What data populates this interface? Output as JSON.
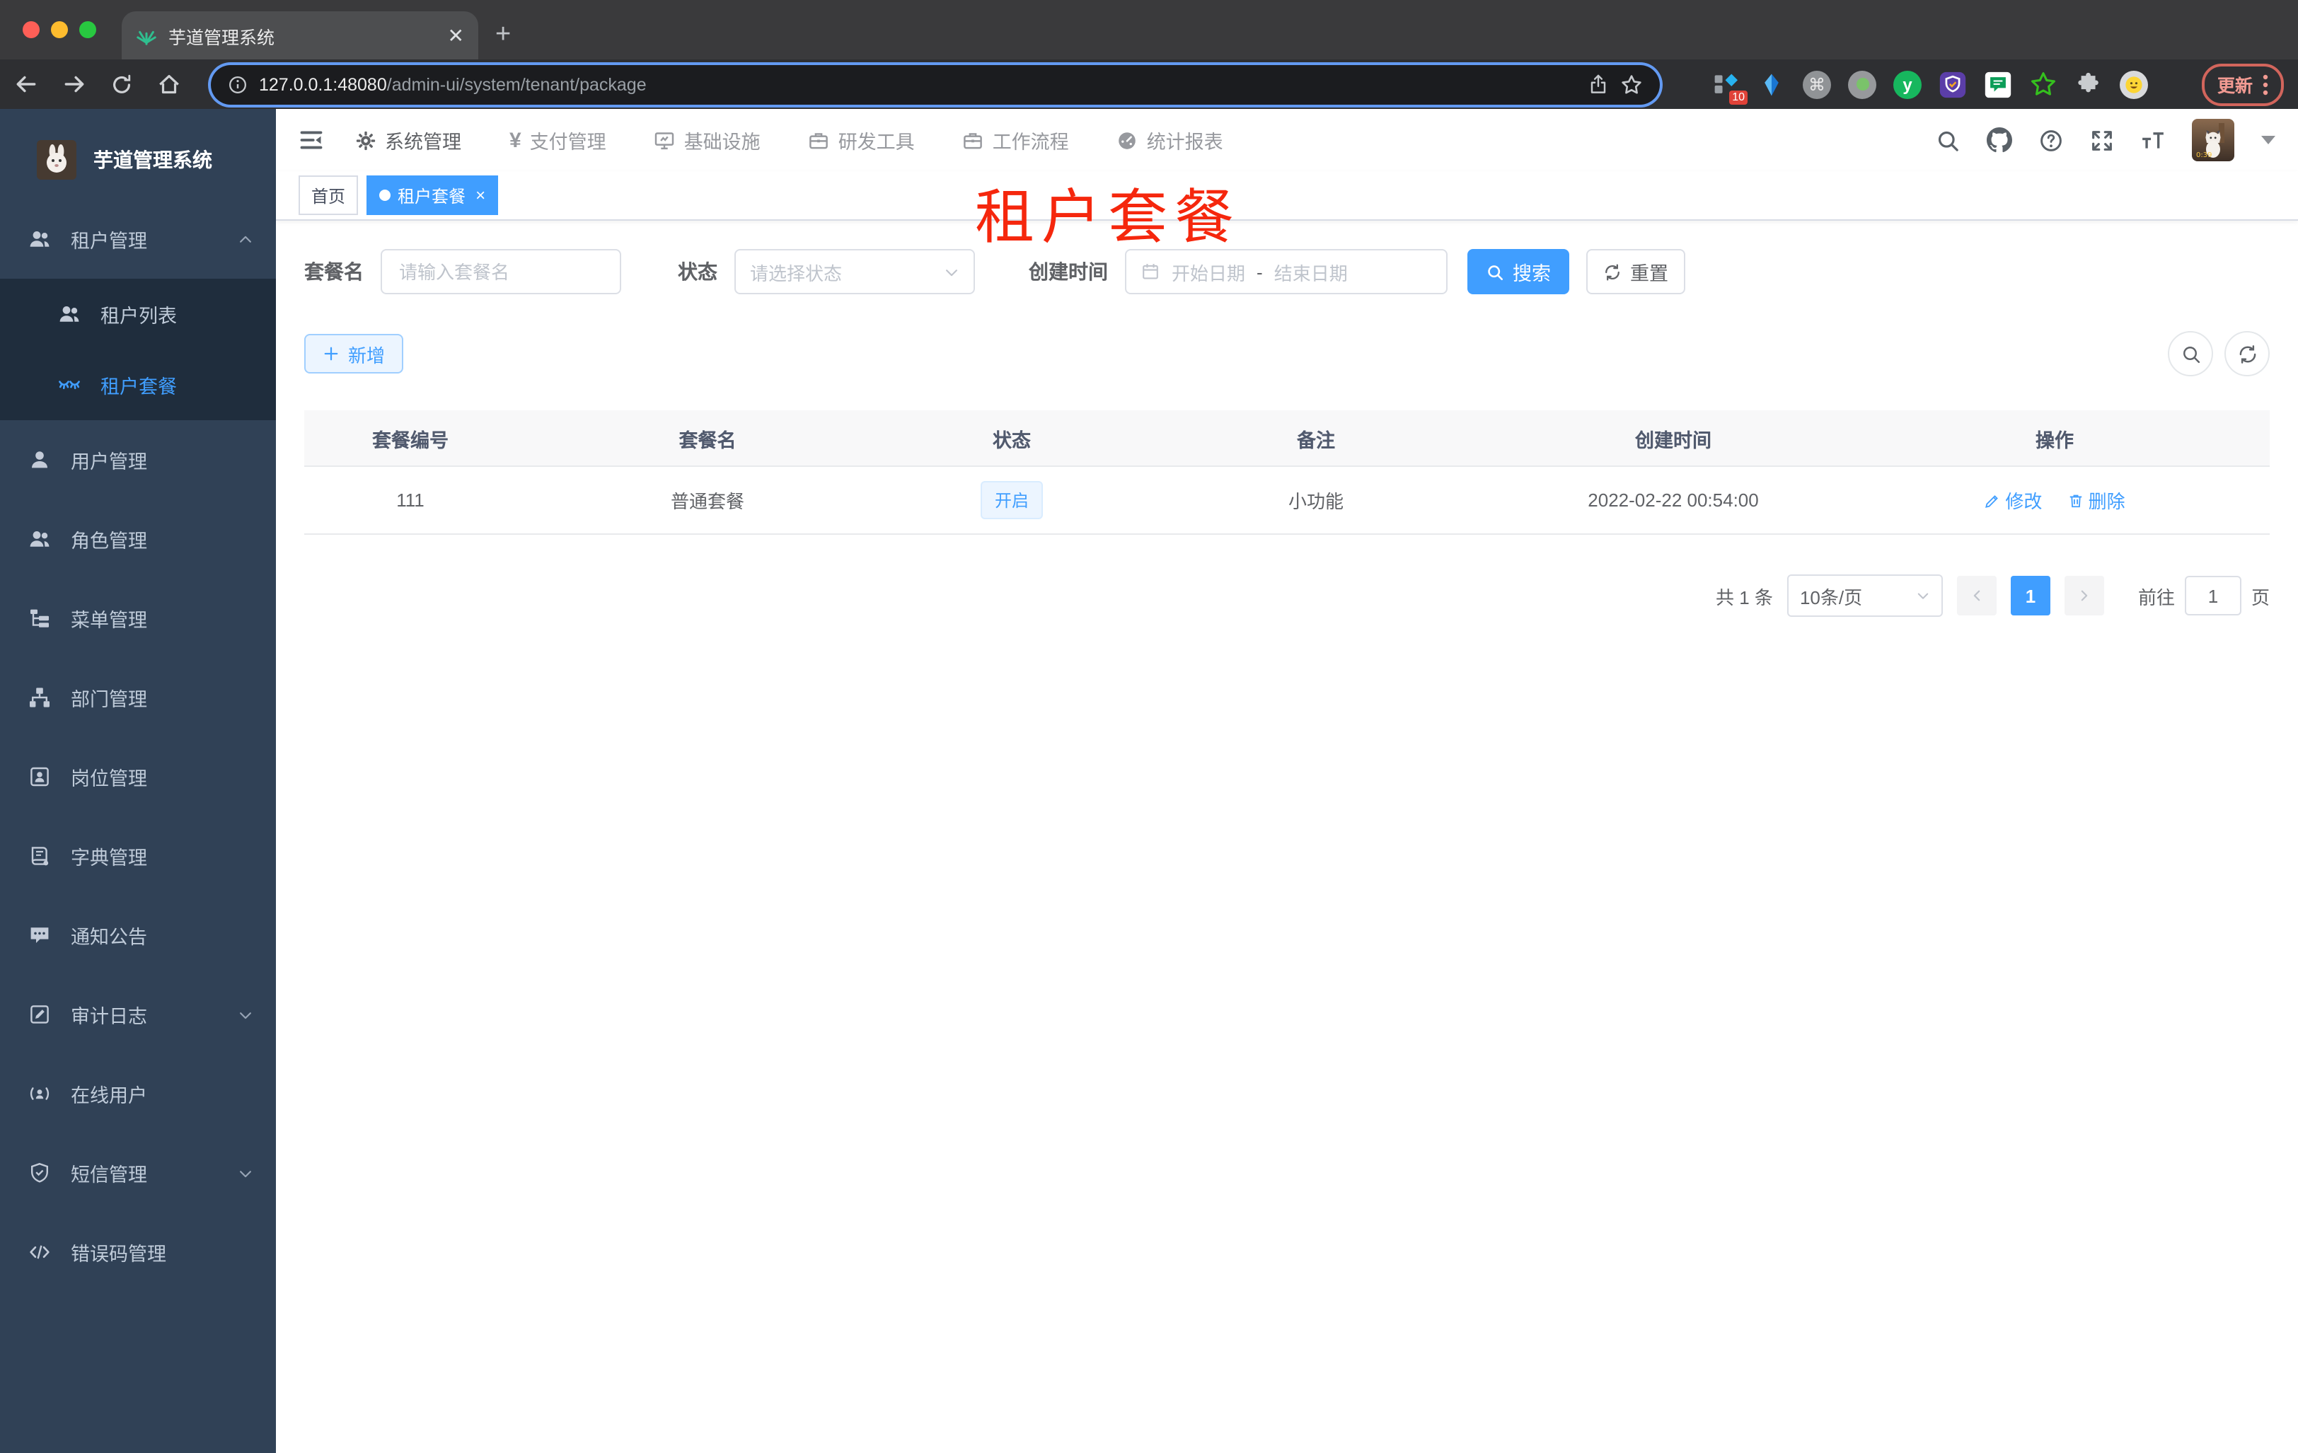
{
  "browser": {
    "tab_title": "芋道管理系统",
    "url_host": "127.0.0.1:48080",
    "url_path": "/admin-ui/system/tenant/package",
    "extension_badge": "10",
    "update_label": "更新"
  },
  "sidebar": {
    "logo_title": "芋道管理系统",
    "items": [
      {
        "label": "租户管理",
        "icon": "users-icon",
        "state": "expanded"
      },
      {
        "label": "租户列表",
        "icon": "users-icon",
        "submenu": true
      },
      {
        "label": "租户套餐",
        "icon": "glasses-icon",
        "submenu": true,
        "active": true
      },
      {
        "label": "用户管理",
        "icon": "user-icon"
      },
      {
        "label": "角色管理",
        "icon": "users-icon"
      },
      {
        "label": "菜单管理",
        "icon": "tree-icon"
      },
      {
        "label": "部门管理",
        "icon": "org-icon"
      },
      {
        "label": "岗位管理",
        "icon": "badge-icon"
      },
      {
        "label": "字典管理",
        "icon": "dict-icon"
      },
      {
        "label": "通知公告",
        "icon": "message-icon"
      },
      {
        "label": "审计日志",
        "icon": "log-icon",
        "state": "collapsed"
      },
      {
        "label": "在线用户",
        "icon": "online-icon"
      },
      {
        "label": "短信管理",
        "icon": "shield-icon",
        "state": "collapsed"
      },
      {
        "label": "错误码管理",
        "icon": "code-icon"
      }
    ]
  },
  "header": {
    "nav": [
      {
        "label": "系统管理",
        "icon": "gear-icon",
        "active": true
      },
      {
        "label": "支付管理",
        "icon": "yen-icon"
      },
      {
        "label": "基础设施",
        "icon": "monitor-icon"
      },
      {
        "label": "研发工具",
        "icon": "briefcase-icon"
      },
      {
        "label": "工作流程",
        "icon": "workflow-icon"
      },
      {
        "label": "统计报表",
        "icon": "dashboard-icon"
      }
    ],
    "action_icons": [
      "search-icon",
      "github-icon",
      "question-icon",
      "fullscreen-icon",
      "font-size-icon"
    ],
    "yen_glyph": "¥"
  },
  "tags": {
    "home": "首页",
    "active_tag": "租户套餐"
  },
  "overlay_title": "租户套餐",
  "filters": {
    "name_label": "套餐名",
    "name_placeholder": "请输入套餐名",
    "status_label": "状态",
    "status_placeholder": "请选择状态",
    "date_label": "创建时间",
    "date_start_placeholder": "开始日期",
    "date_separator": "-",
    "date_end_placeholder": "结束日期",
    "search_label": "搜索",
    "reset_label": "重置"
  },
  "toolbar": {
    "add_label": "新增"
  },
  "table": {
    "columns": [
      "套餐编号",
      "套餐名",
      "状态",
      "备注",
      "创建时间",
      "操作"
    ],
    "rows": [
      {
        "id": "111",
        "name": "普通套餐",
        "status": "开启",
        "remark": "小功能",
        "created_at": "2022-02-22 00:54:00",
        "edit_label": "修改",
        "delete_label": "删除"
      }
    ]
  },
  "pagination": {
    "total": "共 1 条",
    "page_size": "10条/页",
    "current_page": "1",
    "goto_label": "前往",
    "goto_value": "1",
    "page_unit": "页"
  },
  "colors": {
    "accent": "#409eff",
    "sidebar_bg": "#304156",
    "submenu_bg": "#1f2d3d",
    "overlay_red": "#f5270d",
    "active_tag_bg": "#409eff"
  }
}
